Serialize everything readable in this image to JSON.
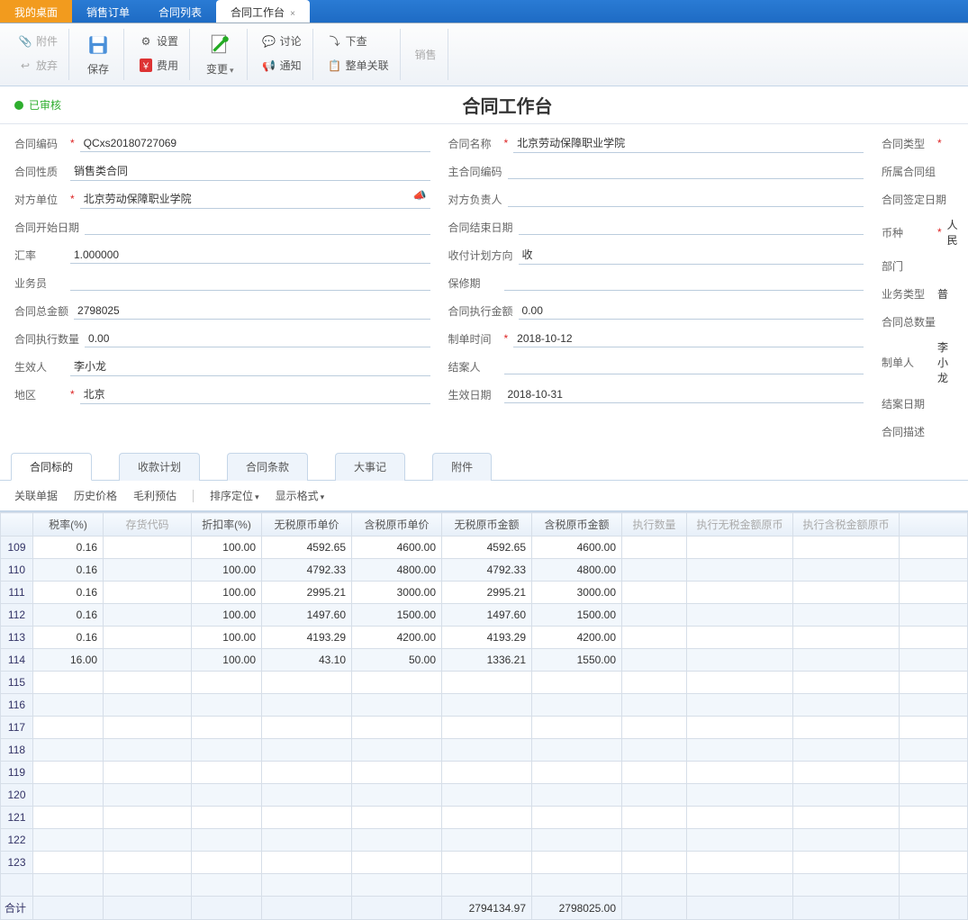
{
  "tabs": {
    "home": "我的桌面",
    "t1": "销售订单",
    "t2": "合同列表",
    "t3": "合同工作台"
  },
  "toolbar": {
    "attach": "附件",
    "discard": "放弃",
    "save": "保存",
    "settings": "设置",
    "cost": "费用",
    "change": "变更",
    "discuss": "讨论",
    "notify": "通知",
    "down": "下查",
    "link": "整单关联",
    "sell": "销售"
  },
  "status": "已审核",
  "page_title": "合同工作台",
  "form": {
    "code_label": "合同编码",
    "code": "QCxs20180727069",
    "nature_label": "合同性质",
    "nature": "销售类合同",
    "party_label": "对方单位",
    "party": "北京劳动保障职业学院",
    "start_label": "合同开始日期",
    "start": "",
    "rate_label": "汇率",
    "rate": "1.000000",
    "sales_label": "业务员",
    "sales": "",
    "total_label": "合同总金额",
    "total": "2798025",
    "exec_qty_label": "合同执行数量",
    "exec_qty": "0.00",
    "effector_label": "生效人",
    "effector": "李小龙",
    "region_label": "地区",
    "region": "北京",
    "name_label": "合同名称",
    "name": "北京劳动保障职业学院",
    "main_code_label": "主合同编码",
    "main_code": "",
    "resp_label": "对方负责人",
    "resp": "",
    "end_label": "合同结束日期",
    "end": "",
    "plan_dir_label": "收付计划方向",
    "plan_dir": "收",
    "warranty_label": "保修期",
    "warranty": "",
    "exec_amt_label": "合同执行金额",
    "exec_amt": "0.00",
    "make_time_label": "制单时间",
    "make_time": "2018-10-12",
    "closer_label": "结案人",
    "closer": "",
    "eff_date_label": "生效日期",
    "eff_date": "2018-10-31",
    "type_label": "合同类型",
    "group_label": "所属合同组",
    "sign_date_label": "合同签定日期",
    "currency_label": "币种",
    "currency": "人民",
    "dept_label": "部门",
    "biz_type_label": "业务类型",
    "biz_type": "普",
    "total_qty_label": "合同总数量",
    "maker_label": "制单人",
    "maker": "李小龙",
    "close_date_label": "结案日期",
    "desc_label": "合同描述"
  },
  "subtabs": [
    "合同标的",
    "收款计划",
    "合同条款",
    "大事记",
    "附件"
  ],
  "subtoolbar": {
    "rel": "关联单据",
    "hist": "历史价格",
    "profit": "毛利预估",
    "sort": "排序定位",
    "disp": "显示格式"
  },
  "grid": {
    "headers": {
      "rate": "税率(%)",
      "code": "存货代码",
      "disc": "折扣率(%)",
      "p1": "无税原币单价",
      "p2": "含税原币单价",
      "a1": "无税原币金额",
      "a2": "含税原币金额",
      "q": "执行数量",
      "e1": "执行无税金额原币",
      "e2": "执行含税金额原币"
    },
    "rows": [
      {
        "n": "109",
        "rate": "0.16",
        "disc": "100.00",
        "p1": "4592.65",
        "p2": "4600.00",
        "a1": "4592.65",
        "a2": "4600.00"
      },
      {
        "n": "110",
        "rate": "0.16",
        "disc": "100.00",
        "p1": "4792.33",
        "p2": "4800.00",
        "a1": "4792.33",
        "a2": "4800.00"
      },
      {
        "n": "111",
        "rate": "0.16",
        "disc": "100.00",
        "p1": "2995.21",
        "p2": "3000.00",
        "a1": "2995.21",
        "a2": "3000.00"
      },
      {
        "n": "112",
        "rate": "0.16",
        "disc": "100.00",
        "p1": "1497.60",
        "p2": "1500.00",
        "a1": "1497.60",
        "a2": "1500.00"
      },
      {
        "n": "113",
        "rate": "0.16",
        "disc": "100.00",
        "p1": "4193.29",
        "p2": "4200.00",
        "a1": "4193.29",
        "a2": "4200.00"
      },
      {
        "n": "114",
        "rate": "16.00",
        "disc": "100.00",
        "p1": "43.10",
        "p2": "50.00",
        "a1": "1336.21",
        "a2": "1550.00"
      },
      {
        "n": "115"
      },
      {
        "n": "116"
      },
      {
        "n": "117"
      },
      {
        "n": "118"
      },
      {
        "n": "119"
      },
      {
        "n": "120"
      },
      {
        "n": "121"
      },
      {
        "n": "122"
      },
      {
        "n": "123"
      },
      {
        "n": ""
      }
    ],
    "footer": {
      "label": "合计",
      "a1": "2794134.97",
      "a2": "2798025.00"
    }
  }
}
